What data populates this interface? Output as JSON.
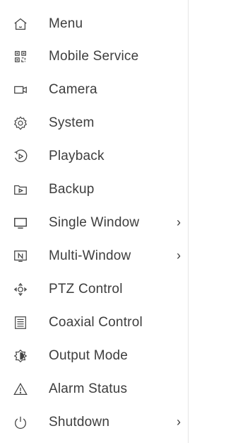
{
  "menu": {
    "items": [
      {
        "label": "Menu",
        "icon": "home-icon"
      },
      {
        "label": "Mobile Service",
        "icon": "qr-code-icon"
      },
      {
        "label": "Camera",
        "icon": "camera-icon"
      },
      {
        "label": "System",
        "icon": "gear-icon"
      },
      {
        "label": "Playback",
        "icon": "playback-icon"
      },
      {
        "label": "Backup",
        "icon": "backup-icon"
      },
      {
        "label": "Single Window",
        "icon": "monitor-icon",
        "submenu": "›"
      },
      {
        "label": "Multi-Window",
        "icon": "multi-window-icon",
        "submenu": "›"
      },
      {
        "label": "PTZ Control",
        "icon": "ptz-icon"
      },
      {
        "label": "Coaxial Control",
        "icon": "coaxial-icon"
      },
      {
        "label": "Output Mode",
        "icon": "output-mode-icon"
      },
      {
        "label": "Alarm Status",
        "icon": "alarm-icon"
      },
      {
        "label": "Shutdown",
        "icon": "power-icon",
        "submenu": "›"
      }
    ]
  }
}
